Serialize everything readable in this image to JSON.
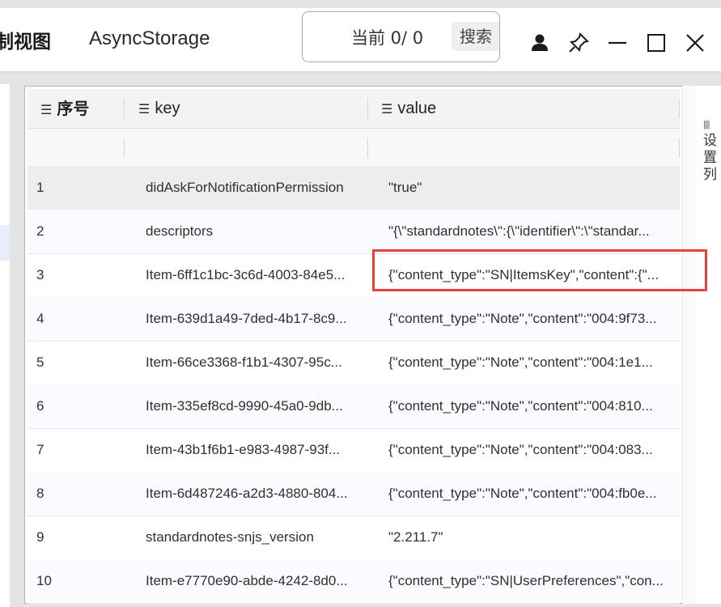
{
  "tabs": {
    "view_label": "制视图",
    "async_label": "AsyncStorage"
  },
  "search": {
    "count_text": "当前 0/ 0",
    "button_label": "搜索"
  },
  "settings": {
    "label": "设置列"
  },
  "table": {
    "columns": [
      "序号",
      "key",
      "value"
    ],
    "rows": [
      {
        "idx": "1",
        "key": "didAskForNotificationPermission",
        "value": "\"true\""
      },
      {
        "idx": "2",
        "key": "descriptors",
        "value": "\"{\\\"standardnotes\\\":{\\\"identifier\\\":\\\"standar..."
      },
      {
        "idx": "3",
        "key": "Item-6ff1c1bc-3c6d-4003-84e5...",
        "value": "{\"content_type\":\"SN|ItemsKey\",\"content\":{\"..."
      },
      {
        "idx": "4",
        "key": "Item-639d1a49-7ded-4b17-8c9...",
        "value": "{\"content_type\":\"Note\",\"content\":\"004:9f73..."
      },
      {
        "idx": "5",
        "key": "Item-66ce3368-f1b1-4307-95c...",
        "value": "{\"content_type\":\"Note\",\"content\":\"004:1e1..."
      },
      {
        "idx": "6",
        "key": "Item-335ef8cd-9990-45a0-9db...",
        "value": "{\"content_type\":\"Note\",\"content\":\"004:810..."
      },
      {
        "idx": "7",
        "key": "Item-43b1f6b1-e983-4987-93f...",
        "value": "{\"content_type\":\"Note\",\"content\":\"004:083..."
      },
      {
        "idx": "8",
        "key": "Item-6d487246-a2d3-4880-804...",
        "value": "{\"content_type\":\"Note\",\"content\":\"004:fb0e..."
      },
      {
        "idx": "9",
        "key": "standardnotes-snjs_version",
        "value": "\"2.211.7\""
      },
      {
        "idx": "10",
        "key": "Item-e7770e90-abde-4242-8d0...",
        "value": "{\"content_type\":\"SN|UserPreferences\",\"con..."
      }
    ]
  },
  "icons": {
    "user": "user-icon",
    "pin": "pin-icon",
    "minimize": "minimize-icon",
    "maximize": "maximize-icon",
    "close": "close-icon",
    "column_menu": "list-icon"
  },
  "colors": {
    "highlight": "#e8413e",
    "selected_row": "#ededed"
  }
}
